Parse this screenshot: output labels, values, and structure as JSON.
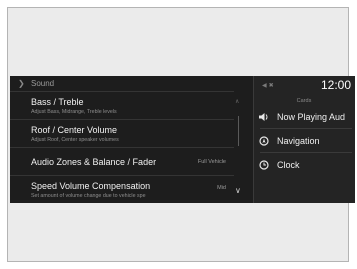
{
  "header": {
    "section_title": "Sound"
  },
  "settings": [
    {
      "title": "Bass / Treble",
      "subtitle": "Adjust Bass, Midrange, Treble levels",
      "value": ""
    },
    {
      "title": "Roof / Center  Volume",
      "subtitle": "Adjust Roof, Center speaker volumes",
      "value": ""
    },
    {
      "title": "Audio Zones & Balance / Fader",
      "subtitle": "",
      "value": "Full Vehicle"
    },
    {
      "title": "Speed Volume Compensation",
      "subtitle": "Set amount of volume change due to vehicle spe",
      "value": "Mid"
    }
  ],
  "side_panel": {
    "time": "12:00",
    "cards_label": "Cards",
    "cards": [
      {
        "label": "Now Playing Aud",
        "icon": "speaker-icon"
      },
      {
        "label": "Navigation",
        "icon": "navigation-icon"
      },
      {
        "label": "Clock",
        "icon": "clock-icon"
      }
    ]
  },
  "colors": {
    "screen_bg": "#1d1d1d",
    "panel_bg": "#242424",
    "frame_bg": "#ebebeb"
  }
}
